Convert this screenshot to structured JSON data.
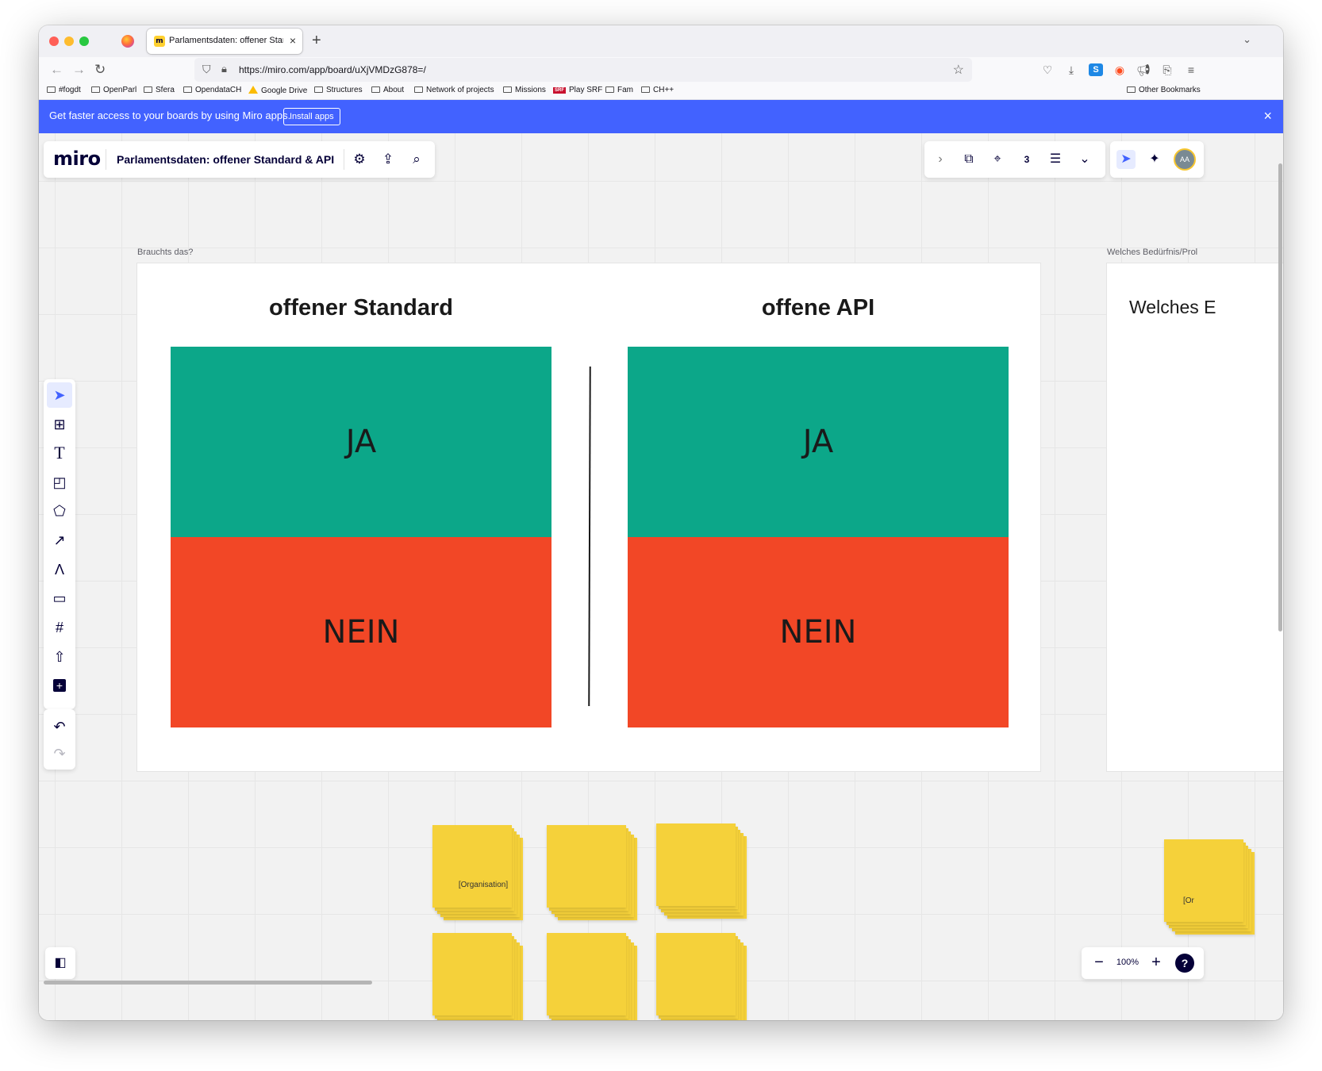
{
  "browser": {
    "tab_title": "Parlamentsdaten: offener Standa",
    "tab_close": "×",
    "new_tab": "+",
    "url": "https://miro.com/app/board/uXjVMDzG878=/",
    "bookmarks": [
      "#fogdt",
      "OpenParl",
      "Sfera",
      "OpendataCH",
      "Google Drive",
      "Structures",
      "About",
      "Network of projects",
      "Missions",
      "Play SRF",
      "Fam",
      "CH++",
      "Other Bookmarks"
    ],
    "srf_badge": "SRF"
  },
  "banner": {
    "text": "Get faster access to your boards by using Miro apps.",
    "button": "Install apps",
    "close": "×",
    "color": "#4262ff"
  },
  "topbar": {
    "logo": "miro",
    "board_title": "Parlamentsdaten: offener Standard & API",
    "icons": [
      "gear-icon",
      "upload-icon",
      "search-icon"
    ],
    "right_icons": [
      "chevron-right-icon",
      "timer-icon",
      "focus-icon",
      "counter-icon",
      "notes-icon",
      "more-icon",
      "cursor-flag-icon",
      "celebrate-icon"
    ],
    "avatar_initials": "AA",
    "counter_value": "3"
  },
  "toolbar": {
    "tools": [
      "select-tool",
      "templates-tool",
      "text-tool",
      "sticky-note-tool",
      "shapes-tool",
      "connection-line-tool",
      "pen-tool",
      "comment-tool",
      "frame-tool",
      "upload-tool",
      "more-apps-tool"
    ],
    "text_tool_label": "T"
  },
  "board": {
    "frame1": {
      "label": "Brauchts das?",
      "left_heading": "offener Standard",
      "right_heading": "offene API",
      "yes": "JA",
      "no": "NEIN"
    },
    "frame2": {
      "label": "Welches Bedürfnis/Prol",
      "heading": "Welches E"
    },
    "sticky_text": "[Organisation]",
    "sticky_text_partial": "[Or",
    "colors": {
      "ja": "#0ca789",
      "nein": "#f24726",
      "sticky": "#f5d13a"
    }
  },
  "zoom": {
    "value": "100%",
    "minus": "−",
    "plus": "+",
    "help": "?"
  }
}
